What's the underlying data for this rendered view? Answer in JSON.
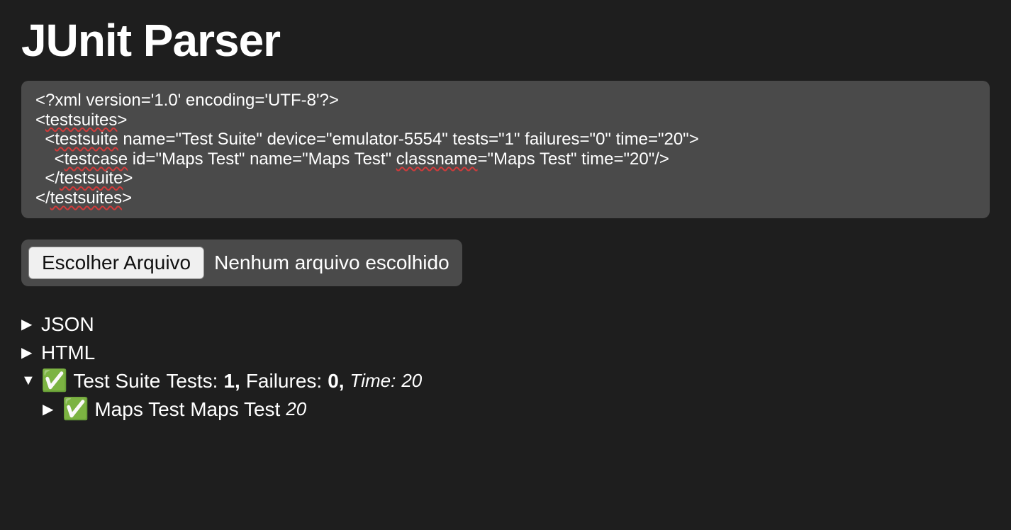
{
  "title": "JUnit Parser",
  "xml": {
    "line1_pre": "<?xml version='1.0' encoding='UTF-8'?>",
    "line2_open": "<",
    "line2_tag": "testsuites",
    "line2_close": ">",
    "line3_pre": "  <",
    "line3_tag": "testsuite",
    "line3_rest": " name=\"Test Suite\" device=\"emulator-5554\" tests=\"1\" failures=\"0\" time=\"20\">",
    "line4_pre": "    <",
    "line4_tag": "testcase",
    "line4_mid1": " id=\"Maps Test\" name=\"Maps Test\" ",
    "line4_attr": "classname",
    "line4_mid2": "=\"Maps Test\" time=\"20\"/>",
    "line5_pre": "  </",
    "line5_tag": "testsuite",
    "line5_close": ">",
    "line6_pre": "</",
    "line6_tag": "testsuites",
    "line6_close": ">"
  },
  "file_picker": {
    "button_label": "Escolher Arquivo",
    "status_text": "Nenhum arquivo escolhido"
  },
  "tree": {
    "json_label": "JSON",
    "html_label": "HTML",
    "suite": {
      "check_icon": "✅",
      "name": "Test Suite",
      "tests_label": "Tests:",
      "tests_value": "1",
      "sep1": ",",
      "failures_label": "Failures:",
      "failures_value": "0",
      "sep2": ",",
      "time_label": "Time:",
      "time_value": "20"
    },
    "testcase": {
      "check_icon": "✅",
      "name": "Maps Test Maps Test",
      "time": "20"
    }
  },
  "icons": {
    "triangle_right": "▶",
    "triangle_down": "▼"
  }
}
